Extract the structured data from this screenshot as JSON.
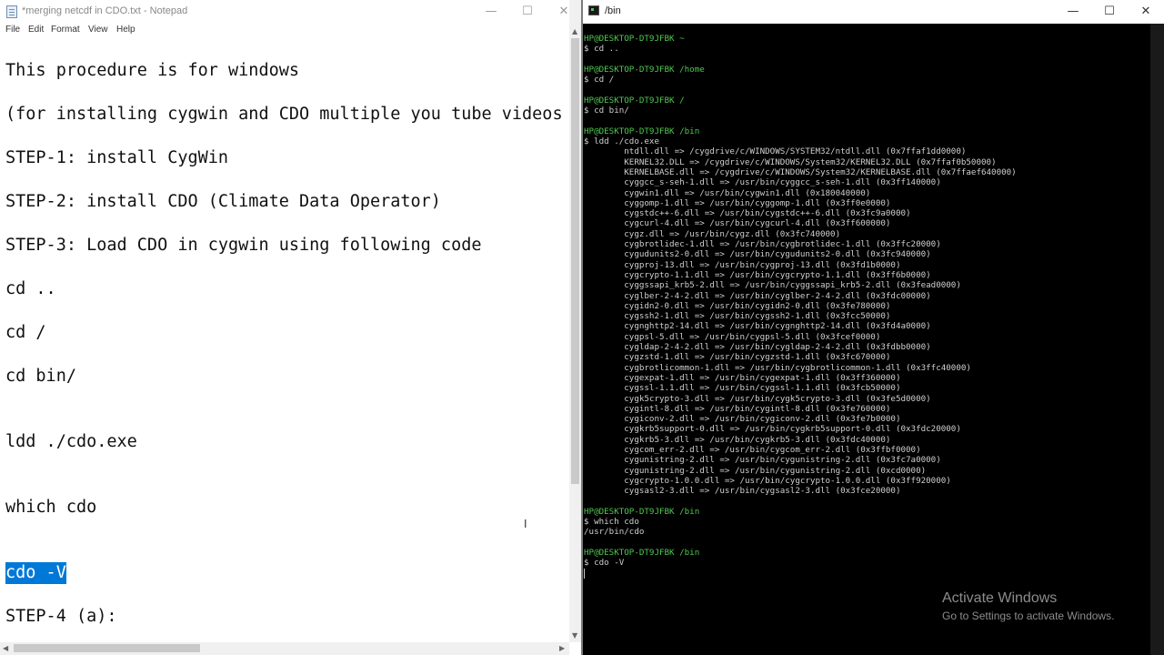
{
  "notepad": {
    "title": "*merging netcdf in CDO.txt - Notepad",
    "menu": [
      "File",
      "Edit",
      "Format",
      "View",
      "Help"
    ],
    "lines": [
      "This procedure is for windows",
      "(for installing cygwin and CDO multiple you tube videos ar",
      "STEP-1: install CygWin",
      "STEP-2: install CDO (Climate Data Operator)",
      "STEP-3: Load CDO in cygwin using following code",
      "cd ..",
      "cd /",
      "cd bin/",
      "ldd ./cdo.exe",
      "which cdo",
      "cdo -V",
      "STEP-4 (a):"
    ]
  },
  "window_controls": {
    "minimize": "—",
    "maximize": "☐",
    "close": "✕"
  },
  "terminal": {
    "title": "/bin",
    "lines": [
      {
        "t": "HP@DESKTOP-DT9JFBK ~",
        "prompt": true
      },
      {
        "t": "$ cd .."
      },
      {
        "t": ""
      },
      {
        "t": "HP@DESKTOP-DT9JFBK /home",
        "prompt": true
      },
      {
        "t": "$ cd /"
      },
      {
        "t": ""
      },
      {
        "t": "HP@DESKTOP-DT9JFBK /",
        "prompt": true
      },
      {
        "t": "$ cd bin/"
      },
      {
        "t": ""
      },
      {
        "t": "HP@DESKTOP-DT9JFBK /bin",
        "prompt": true
      },
      {
        "t": "$ ldd ./cdo.exe"
      },
      {
        "t": "        ntdll.dll => /cygdrive/c/WINDOWS/SYSTEM32/ntdll.dll (0x7ffaf1dd0000)"
      },
      {
        "t": "        KERNEL32.DLL => /cygdrive/c/WINDOWS/System32/KERNEL32.DLL (0x7ffaf0b50000)"
      },
      {
        "t": "        KERNELBASE.dll => /cygdrive/c/WINDOWS/System32/KERNELBASE.dll (0x7ffaef640000)"
      },
      {
        "t": "        cyggcc_s-seh-1.dll => /usr/bin/cyggcc_s-seh-1.dll (0x3ff140000)"
      },
      {
        "t": "        cygwin1.dll => /usr/bin/cygwin1.dll (0x180040000)"
      },
      {
        "t": "        cyggomp-1.dll => /usr/bin/cyggomp-1.dll (0x3ff0e0000)"
      },
      {
        "t": "        cygstdc++-6.dll => /usr/bin/cygstdc++-6.dll (0x3fc9a0000)"
      },
      {
        "t": "        cygcurl-4.dll => /usr/bin/cygcurl-4.dll (0x3ff600000)"
      },
      {
        "t": "        cygz.dll => /usr/bin/cygz.dll (0x3fc740000)"
      },
      {
        "t": "        cygbrotlidec-1.dll => /usr/bin/cygbrotlidec-1.dll (0x3ffc20000)"
      },
      {
        "t": "        cygudunits2-0.dll => /usr/bin/cygudunits2-0.dll (0x3fc940000)"
      },
      {
        "t": "        cygproj-13.dll => /usr/bin/cygproj-13.dll (0x3fd1b0000)"
      },
      {
        "t": "        cygcrypto-1.1.dll => /usr/bin/cygcrypto-1.1.dll (0x3ff6b0000)"
      },
      {
        "t": "        cyggssapi_krb5-2.dll => /usr/bin/cyggssapi_krb5-2.dll (0x3fead0000)"
      },
      {
        "t": "        cyglber-2-4-2.dll => /usr/bin/cyglber-2-4-2.dll (0x3fdc00000)"
      },
      {
        "t": "        cygidn2-0.dll => /usr/bin/cygidn2-0.dll (0x3fe780000)"
      },
      {
        "t": "        cygssh2-1.dll => /usr/bin/cygssh2-1.dll (0x3fcc50000)"
      },
      {
        "t": "        cygnghttp2-14.dll => /usr/bin/cygnghttp2-14.dll (0x3fd4a0000)"
      },
      {
        "t": "        cygpsl-5.dll => /usr/bin/cygpsl-5.dll (0x3fcef0000)"
      },
      {
        "t": "        cygldap-2-4-2.dll => /usr/bin/cygldap-2-4-2.dll (0x3fdbb0000)"
      },
      {
        "t": "        cygzstd-1.dll => /usr/bin/cygzstd-1.dll (0x3fc670000)"
      },
      {
        "t": "        cygbrotlicommon-1.dll => /usr/bin/cygbrotlicommon-1.dll (0x3ffc40000)"
      },
      {
        "t": "        cygexpat-1.dll => /usr/bin/cygexpat-1.dll (0x3ff360000)"
      },
      {
        "t": "        cygssl-1.1.dll => /usr/bin/cygssl-1.1.dll (0x3fcb50000)"
      },
      {
        "t": "        cygk5crypto-3.dll => /usr/bin/cygk5crypto-3.dll (0x3fe5d0000)"
      },
      {
        "t": "        cygintl-8.dll => /usr/bin/cygintl-8.dll (0x3fe760000)"
      },
      {
        "t": "        cygiconv-2.dll => /usr/bin/cygiconv-2.dll (0x3fe7b0000)"
      },
      {
        "t": "        cygkrb5support-0.dll => /usr/bin/cygkrb5support-0.dll (0x3fdc20000)"
      },
      {
        "t": "        cygkrb5-3.dll => /usr/bin/cygkrb5-3.dll (0x3fdc40000)"
      },
      {
        "t": "        cygcom_err-2.dll => /usr/bin/cygcom_err-2.dll (0x3ffbf0000)"
      },
      {
        "t": "        cygunistring-2.dll => /usr/bin/cygunistring-2.dll (0x3fc7a0000)"
      },
      {
        "t": "        cygunistring-2.dll => /usr/bin/cygunistring-2.dll (0xcd0000)"
      },
      {
        "t": "        cygcrypto-1.0.0.dll => /usr/bin/cygcrypto-1.0.0.dll (0x3ff920000)"
      },
      {
        "t": "        cygsasl2-3.dll => /usr/bin/cygsasl2-3.dll (0x3fce20000)"
      },
      {
        "t": ""
      },
      {
        "t": "HP@DESKTOP-DT9JFBK /bin",
        "prompt": true
      },
      {
        "t": "$ which cdo"
      },
      {
        "t": "/usr/bin/cdo"
      },
      {
        "t": ""
      },
      {
        "t": "HP@DESKTOP-DT9JFBK /bin",
        "prompt": true
      },
      {
        "t": "$ cdo -V"
      }
    ],
    "watermark": {
      "line1": "Activate Windows",
      "line2": "Go to Settings to activate Windows."
    }
  }
}
